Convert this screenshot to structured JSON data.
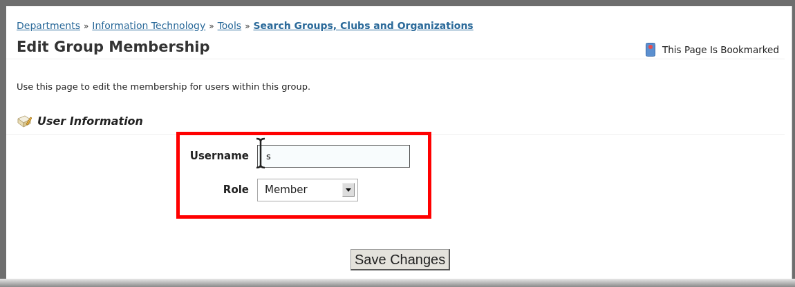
{
  "breadcrumbs": [
    {
      "label": "Departments",
      "current": false
    },
    {
      "label": "Information Technology",
      "current": false
    },
    {
      "label": "Tools",
      "current": false
    },
    {
      "label": "Search Groups, Clubs and Organizations",
      "current": true
    }
  ],
  "breadcrumb_separator": "»",
  "title": "Edit Group Membership",
  "bookmark": {
    "label": "This Page Is Bookmarked"
  },
  "description": "Use this page to edit the membership for users within this group.",
  "section": {
    "title": "User Information"
  },
  "form": {
    "highlighted": true,
    "fields": [
      {
        "kind": "text",
        "label": "Username",
        "value": "s"
      },
      {
        "kind": "select",
        "label": "Role",
        "value": "Member"
      }
    ]
  },
  "save_button": "Save Changes"
}
